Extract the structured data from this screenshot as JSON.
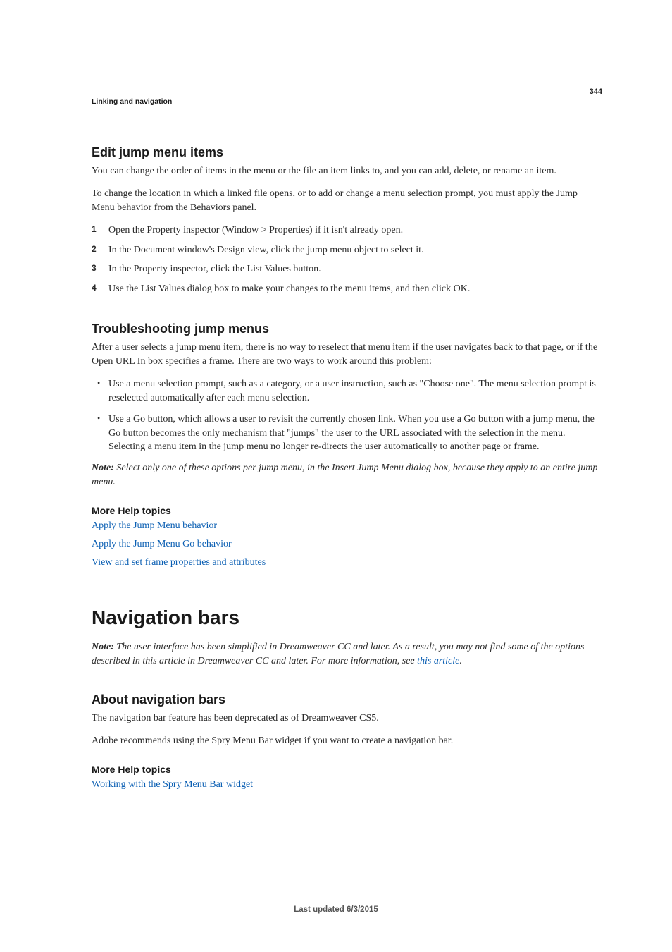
{
  "page_number": "344",
  "running_head": "Linking and navigation",
  "section_edit": {
    "heading": "Edit jump menu items",
    "p1": "You can change the order of items in the menu or the file an item links to, and you can add, delete, or rename an item.",
    "p2": "To change the location in which a linked file opens, or to add or change a menu selection prompt, you must apply the Jump Menu behavior from the Behaviors panel.",
    "steps": [
      "Open the Property inspector (Window > Properties) if it isn't already open.",
      "In the Document window's Design view, click the jump menu object to select it.",
      "In the Property inspector, click the List Values button.",
      "Use the List Values dialog box to make your changes to the menu items, and then click OK."
    ]
  },
  "section_trouble": {
    "heading": "Troubleshooting jump menus",
    "p1": "After a user selects a jump menu item, there is no way to reselect that menu item if the user navigates back to that page, or if the Open URL In box specifies a frame. There are two ways to work around this problem:",
    "bullets": [
      "Use a menu selection prompt, such as a category, or a user instruction, such as \"Choose one\". The menu selection prompt is reselected automatically after each menu selection.",
      "Use a Go button, which allows a user to revisit the currently chosen link. When you use a Go button with a jump menu, the Go button becomes the only mechanism that \"jumps\" the user to the URL associated with the selection in the menu. Selecting a menu item in the jump menu no longer re-directs the user automatically to another page or frame."
    ],
    "note_label": "Note:",
    "note_text": " Select only one of these options per jump menu, in the Insert Jump Menu dialog box, because they apply to an entire jump menu.",
    "more_help_heading": "More Help topics",
    "links": [
      "Apply the Jump Menu behavior",
      "Apply the Jump Menu Go behavior",
      "View and set frame properties and attributes"
    ]
  },
  "chapter_nav": {
    "heading": "Navigation bars",
    "note_label": "Note:",
    "note_text_before": " The user interface has been simplified in Dreamweaver CC and later. As a result, you may not find some of the options described in this article in Dreamweaver CC and later. For more information, see ",
    "note_link": "this article",
    "note_text_after": ".",
    "about_heading": "About navigation bars",
    "p1": "The navigation bar feature has been deprecated as of Dreamweaver CS5.",
    "p2": "Adobe recommends using the Spry Menu Bar widget if you want to create a navigation bar.",
    "more_help_heading": "More Help topics",
    "links": [
      "Working with the Spry Menu Bar widget"
    ]
  },
  "footer": "Last updated 6/3/2015"
}
